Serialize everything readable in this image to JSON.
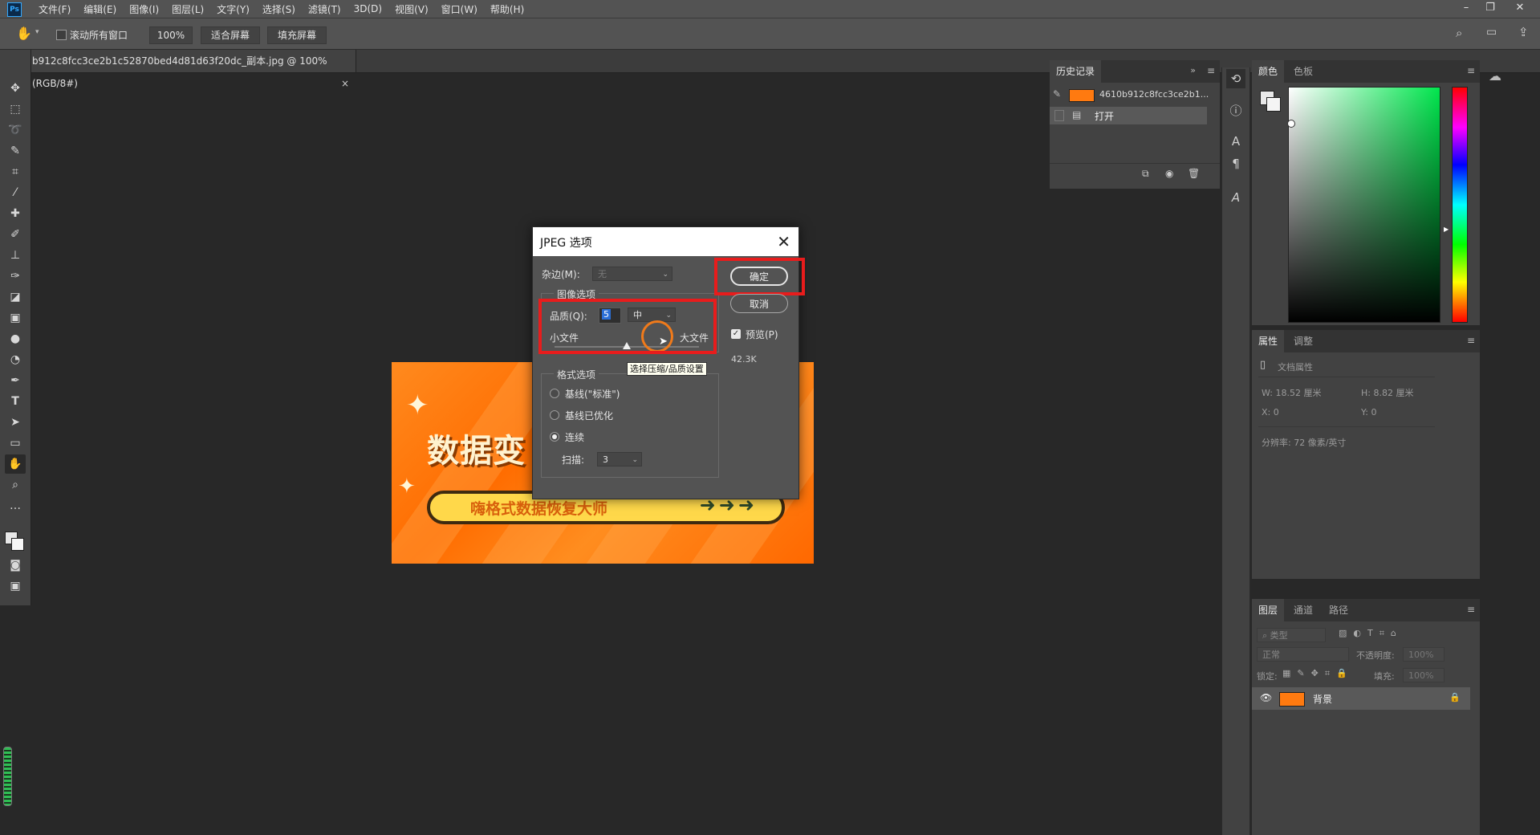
{
  "app": {
    "logo": "Ps"
  },
  "menu": [
    "文件(F)",
    "编辑(E)",
    "图像(I)",
    "图层(L)",
    "文字(Y)",
    "选择(S)",
    "滤镜(T)",
    "3D(D)",
    "视图(V)",
    "窗口(W)",
    "帮助(H)"
  ],
  "window_controls": {
    "minimize": "–",
    "restore": "❐",
    "close": "✕"
  },
  "options_bar": {
    "scroll_all_label": "滚动所有窗口",
    "zoom_value": "100%",
    "fit_screen_label": "适合屏幕",
    "fill_screen_label": "填充屏幕"
  },
  "document_tab": {
    "title": "b912c8fcc3ce2b1c52870bed4d81d63f20dc_副本.jpg @ 100%(RGB/8#)",
    "close": "×"
  },
  "banner": {
    "title": "数据变",
    "subtitle": "嗨格式数据恢复大师",
    "arrows": "➜➜➜"
  },
  "dialog": {
    "title": "JPEG 选项",
    "matte_label": "杂边(M):",
    "matte_value": "无",
    "image_options_legend": "图像选项",
    "quality_label": "品质(Q):",
    "quality_value": "5",
    "quality_level": "中",
    "small_file_label": "小文件",
    "large_file_label": "大文件",
    "slider_fraction": 0.5,
    "tooltip": "选择压缩/品质设置",
    "format_options_legend": "格式选项",
    "format_options": [
      {
        "label": "基线(\"标准\")",
        "selected": false
      },
      {
        "label": "基线已优化",
        "selected": false
      },
      {
        "label": "连续",
        "selected": true
      }
    ],
    "scans_label": "扫描:",
    "scans_value": "3",
    "ok_label": "确定",
    "cancel_label": "取消",
    "preview_label": "预览(P)",
    "preview_checked": true,
    "file_size": "42.3K"
  },
  "history_panel": {
    "tab": "历史记录",
    "items": [
      {
        "label": "4610b912c8fcc3ce2b1..."
      },
      {
        "label": "打开"
      }
    ]
  },
  "color_panel": {
    "tabs": [
      "颜色",
      "色板"
    ]
  },
  "properties_panel": {
    "tabs": [
      "属性",
      "调整"
    ],
    "doc_props_label": "文档属性",
    "w_label": "W:",
    "w_value": "18.52 厘米",
    "h_label": "H:",
    "h_value": "8.82 厘米",
    "x_label": "X:",
    "x_value": "0",
    "y_label": "Y:",
    "y_value": "0",
    "resolution": "分辨率: 72 像素/英寸"
  },
  "layers_panel": {
    "tabs": [
      "图层",
      "通道",
      "路径"
    ],
    "filter_placeholder": "类型",
    "blend_mode": "正常",
    "opacity_label": "不透明度:",
    "opacity_value": "100%",
    "lock_label": "锁定:",
    "fill_label": "填充:",
    "fill_value": "100%",
    "layers": [
      {
        "name": "背景",
        "visible": true,
        "locked": true
      }
    ]
  },
  "colors": {
    "highlight_red": "#e81c1c",
    "cursor_ring": "#f07a1a",
    "banner_orange": "#ff7a10"
  }
}
